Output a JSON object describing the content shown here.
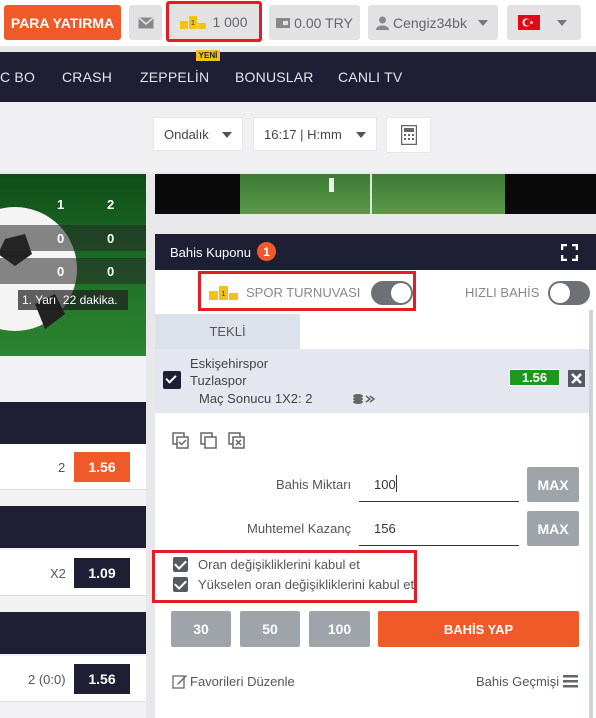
{
  "topbar": {
    "deposit_label": "PARA YATIRMA",
    "points": "1 000",
    "balance": "0.00 TRY",
    "username": "Cengiz34bk"
  },
  "nav": {
    "items": [
      "C BO",
      "CRASH",
      "ZEPPELİN",
      "BONUSLAR",
      "CANLI TV"
    ],
    "new_badge": "YENİ"
  },
  "filters": {
    "odds_format": "Ondalık",
    "time_format": "16:17 | H:mm"
  },
  "score": {
    "rows": [
      [
        "1",
        "2"
      ],
      [
        "0",
        "0"
      ],
      [
        "0",
        "0"
      ]
    ],
    "status": "1. Yarı  22 dakika."
  },
  "left_markets": [
    {
      "label": "2",
      "odd": "1.56"
    },
    {
      "label": "X2",
      "odd": "1.09"
    },
    {
      "label": "2 (0:0)",
      "odd": "1.56"
    }
  ],
  "coupon": {
    "title": "Bahis Kuponu",
    "count": "1",
    "tournament_label": "SPOR TURNUVASI",
    "quick_bet_label": "HIZLI BAHİS",
    "tab_single": "TEKLİ",
    "bet": {
      "team1": "Eskişehirspor",
      "team2": "Tuzlaspor",
      "market": "Maç Sonucu 1X2: 2",
      "odd": "1.56"
    },
    "stake_label": "Bahis Miktarı",
    "stake_value": "100",
    "win_label": "Muhtemel Kazanç",
    "win_value": "156",
    "max_label": "MAX",
    "accept_changes": "Oran değişikliklerini kabul et",
    "accept_increases": "Yükselen oran değişikliklerini kabul et",
    "quick_amounts": [
      "30",
      "50",
      "100"
    ],
    "place_bet": "BAHİS YAP",
    "edit_favorites": "Favorileri Düzenle",
    "bet_history": "Bahis Geçmişi"
  },
  "colors": {
    "accent": "#f05a28",
    "navy": "#1e1f35",
    "highlight": "#e21d25",
    "odd_green": "#1a9a1a"
  }
}
